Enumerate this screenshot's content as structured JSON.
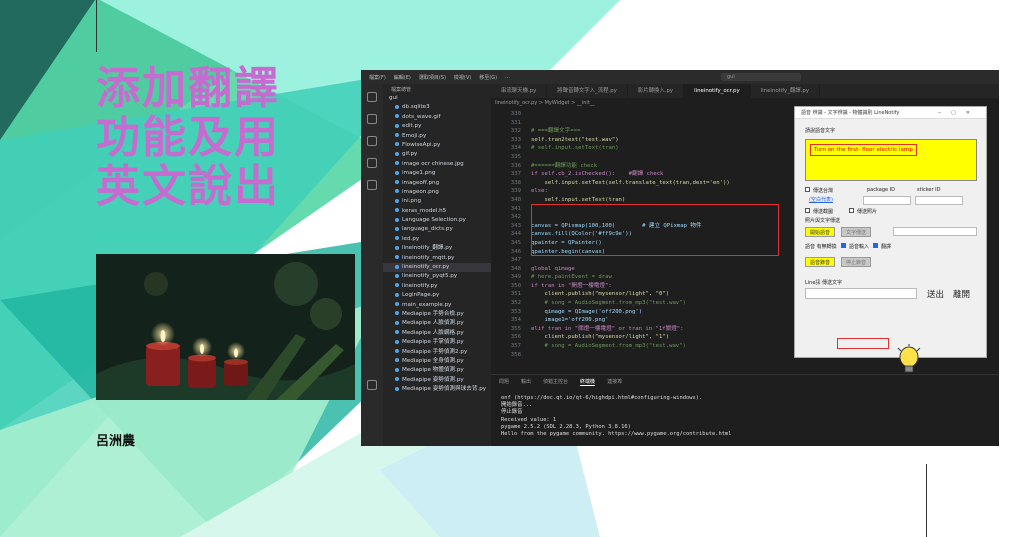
{
  "slide": {
    "title_lines": [
      "添加翻譯",
      "功能及用",
      "英文說出"
    ],
    "author": "呂洲農"
  },
  "screenshot": {
    "menu": [
      "檔案(F)",
      "編輯(E)",
      "選取項目(S)",
      "檢視(V)",
      "移至(G)",
      "..."
    ],
    "search": "gui",
    "sidebar": {
      "header": "檔案總管",
      "folder": "gui",
      "files": [
        "db.sqlite3",
        "dots_wave.gif",
        "edit.py",
        "Emoji.py",
        "FlowiseApi.py",
        "gif.py",
        "image ocr chinese.jpg",
        "image1.png",
        "imageoff.png",
        "imageon.png",
        "ini.png",
        "keras_model.h5",
        "Language Selection.py",
        "language_dicts.py",
        "led.py",
        "lineinotify_翻譯.py",
        "lineinotify_mqtt.py",
        "lineinotify_ocr.py",
        "lineinotify_pyqt5.py",
        "lineinotify.py",
        "LoginPage.py",
        "main_example.py",
        "Mediapipe 手勢合檢.py",
        "Mediapipe 人臉偵測.py",
        "Mediapipe 人臉網格.py",
        "Mediapipe 手掌偵測.py",
        "Mediapipe 手勢偵測2.py",
        "Mediapipe 全身偵測.py",
        "Mediapipe 物體偵測.py",
        "Mediapipe 姿勢偵測.py",
        "Mediapipe 姿勢偵測與球去背.py"
      ],
      "selected_index": 17
    },
    "tabs": [
      "串流聊天機.py",
      "將聲音轉文字入_流程.py",
      "影片轉換入.py",
      "lineinotify_ocr.py",
      "lineinotify_翻譯.py"
    ],
    "active_tab": 3,
    "breadcrumb": "lineinotify_ocr.py > MyWidget > __init__",
    "line_numbers": [
      "330",
      "331",
      "332",
      "333",
      "334",
      "335",
      "336",
      "337",
      "338",
      "339",
      "340",
      "341",
      "342",
      "343",
      "344",
      "345",
      "346",
      "347",
      "348",
      "349",
      "350",
      "351",
      "352",
      "353",
      "354",
      "355",
      "356",
      "357",
      "358"
    ],
    "code_lines": [
      "",
      "",
      "# ===翻譯文字===",
      "self.tran2text(\"test.wav\")",
      "# self.input.setText(tran)",
      "",
      "#======翻譯功能 check",
      "if self.cb_2.isChecked():    #翻譯 check",
      "    self.input.setText(self.translate_text(tran,dest='en'))",
      "else:",
      "    self.input.setText(tran)",
      "",
      "",
      "canvas = QPixmap(100,100)        # 建立 QPixmap 物件",
      "canvas.fill(QColor('#ff9c9e'))",
      "qpainter = QPainter()",
      "qpainter.begin(canvas)",
      "",
      "global qimage",
      "# here.paintEvent = draw",
      "if tran in \"開燈一樓電燈\":",
      "    client.publish(\"mysensor/light\", \"0\")",
      "    # song = AudioSegment.from_mp3(\"test.wav\")",
      "    qimage = QImage('off200.png')",
      "    image1='off200.png'",
      "elif tran in \"關燈一樓電燈\" or tran in \"1f關燈\":",
      "    client.publish(\"mysensor/light\", \"1\")",
      "    # song = AudioSegment.from_mp3(\"test.wav\")",
      ""
    ],
    "panel_tabs": [
      "問題",
      "輸出",
      "偵錯主控台",
      "終端機",
      "連接埠"
    ],
    "terminal": [
      "onf (https://doc.qt.io/qt-6/highdpi.html#configuring-windows).",
      "開始錄音...",
      "停止錄音",
      "Received value: 1",
      "pygame 2.5.2 (SDL 2.28.3, Python 3.8.16)",
      "Hello from the pygame community. https://www.pygame.org/contribute.html"
    ],
    "dialog": {
      "title": "語音 辨識 - 文字辨識 - 物體識別 LineNotify",
      "prompt": "請說語音文字",
      "result": "Turn on the first- floor electric lamp",
      "line_label": "傳送台灣",
      "package_label": "package ID",
      "sticker_label": "sticker ID",
      "check_link": "(空白代表)",
      "chk1": "傳送截圖",
      "chk2": "傳送照片",
      "section": "照片與文字傳送",
      "btn_start": "開始語音",
      "btn_text": "文字傳送",
      "trans_label": "語音 有無轉換",
      "chk_trans": "語音輸入",
      "chk_en": "翻譯",
      "btn_record": "語音錄音",
      "btn_off": "停止錄音",
      "line_input_label": "Line訊 傳送文字",
      "send": "送出",
      "leave": "離開"
    }
  },
  "colors": {
    "title": "#c86bd0",
    "teal_light": "#8ff0dc",
    "teal_mid": "#3ccfb4",
    "green": "#5fd68a",
    "highlight_red": "#e23030",
    "dialog_yellow": "#ffff00"
  },
  "icons": [
    "explorer-icon",
    "search-icon",
    "source-control-icon",
    "run-debug-icon",
    "extensions-icon",
    "account-icon",
    "settings-icon",
    "bulb-icon"
  ]
}
